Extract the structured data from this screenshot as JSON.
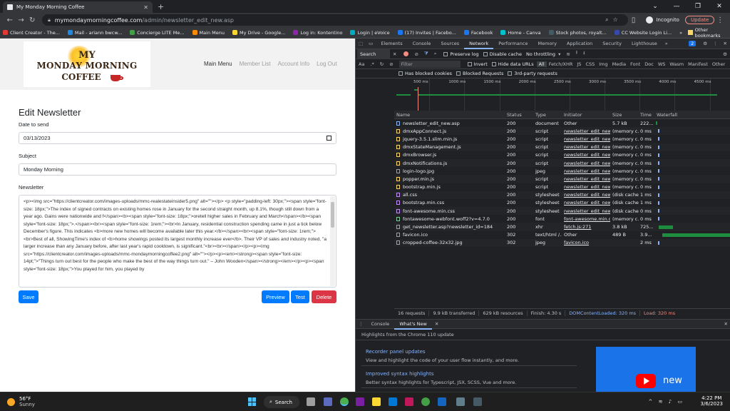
{
  "browser": {
    "tab_title": "My Monday Morning Coffee",
    "url_host": "mymondaymorningcoffee.com",
    "url_path": "/admin/newsletter_edit_new.asp",
    "incognito_label": "Incognito",
    "update_label": "Update"
  },
  "bookmarks": [
    {
      "label": "Client Creator - The...",
      "color": "#e53935"
    },
    {
      "label": "Mail - ariann bwcw...",
      "color": "#1e88e5"
    },
    {
      "label": "Concierge LITE Me...",
      "color": "#43a047"
    },
    {
      "label": "Main Menu",
      "color": "#fb8c00"
    },
    {
      "label": "My Drive - Google...",
      "color": "#fdd835"
    },
    {
      "label": "Log in: Kontentino",
      "color": "#8e24aa"
    },
    {
      "label": "Login | eVoice",
      "color": "#00acc1"
    },
    {
      "label": "(17) Invites | Facebo...",
      "color": "#1877f2"
    },
    {
      "label": "Facebook",
      "color": "#1877f2"
    },
    {
      "label": "Home - Canva",
      "color": "#00c4cc"
    },
    {
      "label": "Stock photos, royalt...",
      "color": "#455a64"
    },
    {
      "label": "CC Website Login Li...",
      "color": "#3949ab"
    }
  ],
  "bookmarks_more": "»",
  "other_bookmarks": "Other bookmarks",
  "site": {
    "logo_line1": "MY",
    "logo_line2": "MONDAY MORNING",
    "logo_line3": "COFFEE",
    "nav": [
      "Main Menu",
      "Member List",
      "Account Info",
      "Log Out"
    ]
  },
  "form": {
    "heading": "Edit Newsletter",
    "date_label": "Date to send",
    "date_value": "03/13/2023",
    "subject_label": "Subject",
    "subject_value": "Monday Morning",
    "newsletter_label": "Newsletter",
    "newsletter_body": "<p><img src=\"https://clientcreator.com/images-uploads/mmc-realestateinsider5.png\" alt=\"\"></p> <p style=\"padding-left: 30px;\"><span style=\"font-size: 18px;\">The index of signed contracts on existing homes rose in January for the second straight month, up 8.1%, though still down from a year ago. Gains were nationwide and f</span><b><span style=\"font-size: 18px;\">oretell higher sales in February and March</span></b><span style=\"font-size: 18px;\">.</span><br><span style=\"font-size: 1rem;\"><br>In January, residential construction spending came in just a tick below December's figure. This indicates <b>more new homes will become available later this year.</b></span><br><span style=\"font-size: 1rem;\"><br>Best of all, ShowingTime's index of <b>home showings posted its largest monthly increase ever</b>. Their VP of sales and industry noted, \"a larger increase than any January before, after last year's rapid cooldown, is significant.\"<br><br></span></p><p><img src=\"https://clientcreator.com/images-uploads/mmc-mondaymorningcoffee2.png\" alt=\"\"></p><p><em><strong><span style=\"font-size: 14pt;\">\"Things turn out best for the people who make the best of the way things turn out.\" – John Wooden</span></strong></em></p><p><span style=\"font-size: 18px;\">You played for him, you played by",
    "save_label": "Save",
    "preview_label": "Preview",
    "test_label": "Test",
    "delete_label": "Delete"
  },
  "devtools": {
    "tabs": [
      "Elements",
      "Console",
      "Sources",
      "Network",
      "Performance",
      "Memory",
      "Application",
      "Security",
      "Lighthouse"
    ],
    "active_tab": "Network",
    "tabs_more": "»",
    "issues_badge": "2",
    "search_tab": "Search",
    "preserve_log": "Preserve log",
    "disable_cache": "Disable cache",
    "throttling": "No throttling",
    "filter_placeholder": "Filter",
    "invert": "Invert",
    "hide_data_urls": "Hide data URLs",
    "filter_types": [
      "All",
      "Fetch/XHR",
      "JS",
      "CSS",
      "Img",
      "Media",
      "Font",
      "Doc",
      "WS",
      "Wasm",
      "Manifest",
      "Other"
    ],
    "has_blocked_cookies": "Has blocked cookies",
    "blocked_requests": "Blocked Requests",
    "third_party": "3rd-party requests",
    "timeline_ticks": [
      "500 ms",
      "1000 ms",
      "1500 ms",
      "2000 ms",
      "2500 ms",
      "3000 ms",
      "3500 ms",
      "4000 ms",
      "4500 ms"
    ],
    "columns": [
      "Name",
      "Status",
      "Type",
      "Initiator",
      "Size",
      "Time",
      "Waterfall"
    ],
    "rows": [
      {
        "name": "newsletter_edit_new.asp",
        "status": "200",
        "type": "document",
        "initiator": "Other",
        "size": "5.7 kB",
        "time": "222...",
        "icon": "#8ab4f8",
        "wf": 0.02
      },
      {
        "name": "dmxAppConnect.js",
        "status": "200",
        "type": "script",
        "initiator": "newsletter_edit_new...",
        "size": "(memory c...",
        "time": "0 ms",
        "icon": "#fdd663",
        "wf": 0.0
      },
      {
        "name": "jquery-3.5.1.slim.min.js",
        "status": "200",
        "type": "script",
        "initiator": "newsletter_edit_new...",
        "size": "(memory c...",
        "time": "0 ms",
        "icon": "#fdd663",
        "wf": 0.0
      },
      {
        "name": "dmxStateManagement.js",
        "status": "200",
        "type": "script",
        "initiator": "newsletter_edit_new...",
        "size": "(memory c...",
        "time": "0 ms",
        "icon": "#fdd663",
        "wf": 0.0
      },
      {
        "name": "dmxBrowser.js",
        "status": "200",
        "type": "script",
        "initiator": "newsletter_edit_new...",
        "size": "(memory c...",
        "time": "0 ms",
        "icon": "#fdd663",
        "wf": 0.0
      },
      {
        "name": "dmxNotifications.js",
        "status": "200",
        "type": "script",
        "initiator": "newsletter_edit_new...",
        "size": "(memory c...",
        "time": "0 ms",
        "icon": "#fdd663",
        "wf": 0.0
      },
      {
        "name": "login-logo.jpg",
        "status": "200",
        "type": "jpeg",
        "initiator": "newsletter_edit_new...",
        "size": "(memory c...",
        "time": "0 ms",
        "icon": "#9aa0a6",
        "wf": 0.0
      },
      {
        "name": "popper.min.js",
        "status": "200",
        "type": "script",
        "initiator": "newsletter_edit_new...",
        "size": "(memory c...",
        "time": "0 ms",
        "icon": "#fdd663",
        "wf": 0.0
      },
      {
        "name": "bootstrap.min.js",
        "status": "200",
        "type": "script",
        "initiator": "newsletter_edit_new...",
        "size": "(memory c...",
        "time": "0 ms",
        "icon": "#fdd663",
        "wf": 0.0
      },
      {
        "name": "all.css",
        "status": "200",
        "type": "stylesheet",
        "initiator": "newsletter_edit_new...",
        "size": "(disk cache)",
        "time": "1 ms",
        "icon": "#c58af9",
        "wf": 0.0
      },
      {
        "name": "bootstrap.min.css",
        "status": "200",
        "type": "stylesheet",
        "initiator": "newsletter_edit_new...",
        "size": "(disk cache)",
        "time": "1 ms",
        "icon": "#c58af9",
        "wf": 0.0
      },
      {
        "name": "font-awesome.min.css",
        "status": "200",
        "type": "stylesheet",
        "initiator": "newsletter_edit_new...",
        "size": "(disk cache)",
        "time": "0 ms",
        "icon": "#c58af9",
        "wf": 0.0
      },
      {
        "name": "fontawesome-webfont.woff2?v=4.7.0",
        "status": "200",
        "type": "font",
        "initiator": "font-awesome.min.css",
        "size": "(memory c...",
        "time": "0 ms",
        "icon": "#81c995",
        "wf": 0.0
      },
      {
        "name": "get_newsletter.asp?newsletter_id=184",
        "status": "200",
        "type": "xhr",
        "initiator": "fetch.js:271",
        "size": "3.8 kB",
        "time": "725...",
        "icon": "#9aa0a6",
        "wf": 0.18
      },
      {
        "name": "favicon.ico",
        "status": "302",
        "type": "text/html /...",
        "initiator": "Other",
        "size": "489 B",
        "time": "3.9...",
        "icon": "#9aa0a6",
        "wf": 0.95
      },
      {
        "name": "cropped-coffee-32x32.jpg",
        "status": "302",
        "type": "jpeg",
        "initiator": "favicon.ico",
        "size": "",
        "time": "2 ms",
        "icon": "#9aa0a6",
        "wf": 0.0
      }
    ],
    "summary": {
      "requests": "16 requests",
      "transferred": "9.9 kB transferred",
      "resources": "629 kB resources",
      "finish": "Finish: 4.30 s",
      "dcl": "DOMContentLoaded: 320 ms",
      "load": "Load: 320 ms"
    },
    "drawer_tabs": [
      "Console",
      "What's New"
    ],
    "whats_new_heading": "Highlights from the Chrome 110 update",
    "cards": [
      {
        "title": "Recorder panel updates",
        "desc": "View and highlight the code of your user flow instantly, and more."
      },
      {
        "title": "Improved syntax highlights",
        "desc": "Better syntax highlights for Typescript, JSX, SCSS, Vue and more."
      }
    ],
    "promo_text": "new"
  },
  "taskbar": {
    "temp": "56°F",
    "condition": "Sunny",
    "search": "Search",
    "time": "4:22 PM",
    "date": "3/6/2023"
  },
  "colors": {
    "primary": "#007bff",
    "danger": "#dc3545",
    "devtools_bg": "#202124"
  }
}
